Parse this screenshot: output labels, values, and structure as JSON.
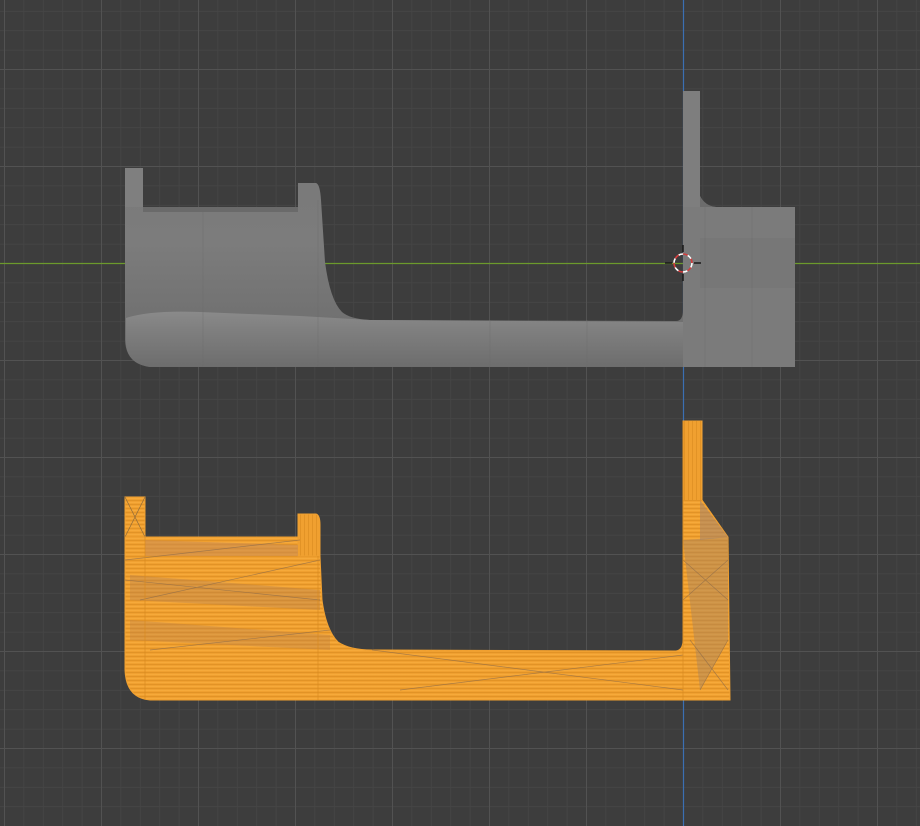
{
  "viewport": {
    "background": "#3d3d3d",
    "grid_minor_color": "#464646",
    "grid_major_color": "#525252",
    "x_axis_color": "#6c9a2c",
    "y_axis_color": "#3b6fb3"
  },
  "objects": [
    {
      "name": "solid-shaded-object",
      "display": "solid",
      "selected": false,
      "color": "#7a7a7a"
    },
    {
      "name": "wireframe-object",
      "display": "wireframe",
      "selected": true,
      "color": "#f0a030"
    }
  ],
  "cursor": {
    "name": "3d-cursor",
    "colors": [
      "#ffffff",
      "#d43c3c"
    ]
  }
}
